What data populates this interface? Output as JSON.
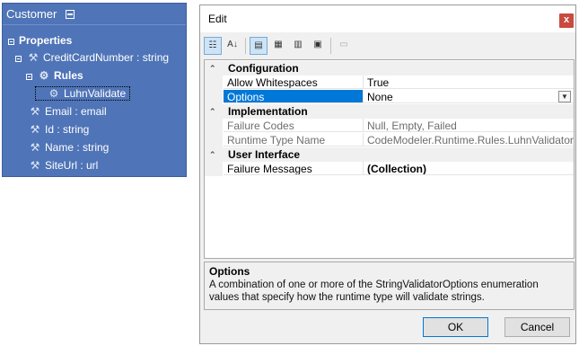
{
  "customer_panel": {
    "title": "Customer",
    "nodes": [
      {
        "label": "Properties"
      },
      {
        "label": "CreditCardNumber : string"
      },
      {
        "label": "Rules"
      },
      {
        "label": "LuhnValidate"
      },
      {
        "label": "Email : email"
      },
      {
        "label": "Id : string"
      },
      {
        "label": "Name : string"
      },
      {
        "label": "SiteUrl : url"
      }
    ]
  },
  "dialog": {
    "title": "Edit",
    "close_label": "x",
    "categories": [
      {
        "label": "Configuration"
      },
      {
        "label": "Implementation"
      },
      {
        "label": "User Interface"
      }
    ],
    "properties": [
      {
        "name": "Allow Whitespaces",
        "value": "True"
      },
      {
        "name": "Options",
        "value": "None"
      },
      {
        "name": "Failure Codes",
        "value": "Null, Empty, Failed"
      },
      {
        "name": "Runtime Type Name",
        "value": "CodeModeler.Runtime.Rules.LuhnValidator, Code"
      },
      {
        "name": "Failure Messages",
        "value": "(Collection)"
      }
    ],
    "description": {
      "title": "Options",
      "text": "A combination of one or more of the StringValidatorOptions enumeration values that specify how the runtime type will validate strings."
    },
    "ok_label": "OK",
    "cancel_label": "Cancel"
  },
  "colors": {
    "panel_bg": "#4f74b7",
    "selection": "#0078d7",
    "close_button": "#c94a3f"
  },
  "icons": [
    "minimize-icon",
    "wrench-icon",
    "rules-icon",
    "validator-icon",
    "categorized-sort-icon",
    "alphabetical-sort-icon",
    "properties-view-icon",
    "events-icon",
    "property-pages-icon",
    "dropdown-arrow-icon"
  ]
}
